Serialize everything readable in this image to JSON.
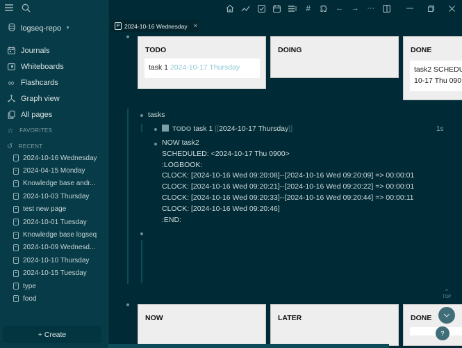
{
  "sidebar": {
    "repo": "logseq-repo",
    "nav": [
      {
        "label": "Journals",
        "icon": "calendar-icon"
      },
      {
        "label": "Whiteboards",
        "icon": "whiteboard-icon"
      },
      {
        "label": "Flashcards",
        "icon": "infinity-icon"
      },
      {
        "label": "Graph view",
        "icon": "graph-icon"
      },
      {
        "label": "All pages",
        "icon": "pages-icon"
      }
    ],
    "favorites_label": "FAVORITES",
    "recent_label": "RECENT",
    "recent": [
      "2024-10-16 Wednesday",
      "2024-04-15 Monday",
      "Knowledge base andr...",
      "2024-10-03 Thursday",
      "test new page",
      "2024-10-01 Tuesday",
      "Knowledge base logseq",
      "2024-10-09 Wednesd...",
      "2024-10-10 Thursday",
      "2024-10-15 Tuesday",
      "type",
      "food"
    ],
    "create_label": "+ Create"
  },
  "toolbar": {
    "icons": [
      "home-icon",
      "graph-activity-icon",
      "checkbox-icon",
      "calendar-icon",
      "list-icon",
      "hash-icon",
      "puzzle-icon",
      "arrow-left-icon",
      "arrow-right-icon",
      "more-icon",
      "sidebar-toggle-icon"
    ],
    "window": [
      "minimize-icon",
      "restore-icon",
      "close-icon"
    ]
  },
  "tab": {
    "badge": "P",
    "title": "2024-10-16 Wednesday"
  },
  "board_top": {
    "columns": [
      {
        "title": "TODO",
        "card": {
          "text": "task 1 ",
          "date": "2024-10-17 Thursday"
        }
      },
      {
        "title": "DOING"
      },
      {
        "title": "DONE",
        "card": {
          "line1": "task2 SCHEDU",
          "line2": "10-17 Thu 090"
        }
      }
    ]
  },
  "outline": {
    "parent": "tasks",
    "task1": {
      "marker": "TODO",
      "text": "task 1",
      "open": "[[",
      "date": "2024-10-17 Thursday",
      "close": "]]",
      "time": "1s"
    },
    "task2": [
      "NOW task2",
      "SCHEDULED: <2024-10-17 Thu 0900>",
      ":LOGBOOK:",
      "CLOCK: [2024-10-16 Wed 09:20:08]--[2024-10-16 Wed 09:20:09] =>  00:00:01",
      "CLOCK: [2024-10-16 Wed 09:20:21]--[2024-10-16 Wed 09:20:22] =>  00:00:01",
      "CLOCK: [2024-10-16 Wed 09:20:33]--[2024-10-16 Wed 09:20:44] =>  00:00:11",
      "CLOCK: [2024-10-16 Wed 09:20:46]",
      ":END:"
    ]
  },
  "board_bottom": {
    "columns": [
      {
        "title": "NOW"
      },
      {
        "title": "LATER"
      },
      {
        "title": "DONE"
      }
    ]
  },
  "floating": {
    "top_label": "TOP",
    "help": "?"
  }
}
